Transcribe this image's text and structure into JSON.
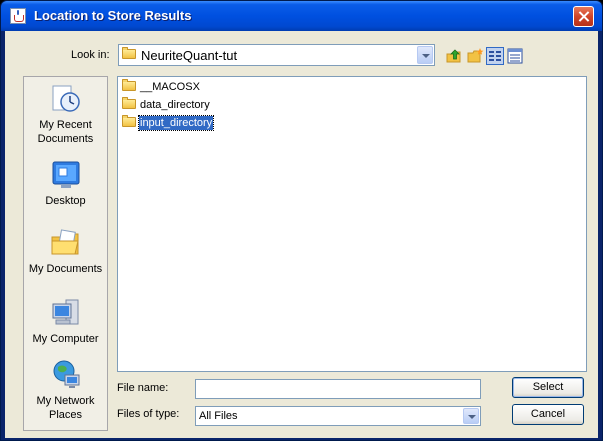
{
  "window": {
    "title": "Location to Store Results"
  },
  "toolbar": {
    "look_in_label": "Look in:",
    "look_in_value": "NeuriteQuant-tut",
    "icons": [
      "up-one-level-icon",
      "create-new-folder-icon",
      "list-view-icon",
      "details-view-icon"
    ]
  },
  "sidebar": {
    "items": [
      {
        "label": "My Recent\nDocuments",
        "icon": "recent-documents-icon"
      },
      {
        "label": "Desktop",
        "icon": "desktop-icon"
      },
      {
        "label": "My Documents",
        "icon": "my-documents-icon"
      },
      {
        "label": "My Computer",
        "icon": "my-computer-icon"
      },
      {
        "label": "My Network\nPlaces",
        "icon": "network-places-icon"
      }
    ]
  },
  "files": [
    {
      "name": "__MACOSX",
      "selected": false
    },
    {
      "name": "data_directory",
      "selected": false
    },
    {
      "name": "input_directory",
      "selected": true
    }
  ],
  "form": {
    "file_name_label": "File name:",
    "file_name_value": "",
    "file_type_label": "Files of type:",
    "file_type_value": "All Files"
  },
  "buttons": {
    "select": "Select",
    "cancel": "Cancel"
  },
  "colors": {
    "titlebar": "#0050e0",
    "selection": "#316ac5",
    "dialog_bg": "#ece9d8",
    "close": "#d0452a"
  }
}
